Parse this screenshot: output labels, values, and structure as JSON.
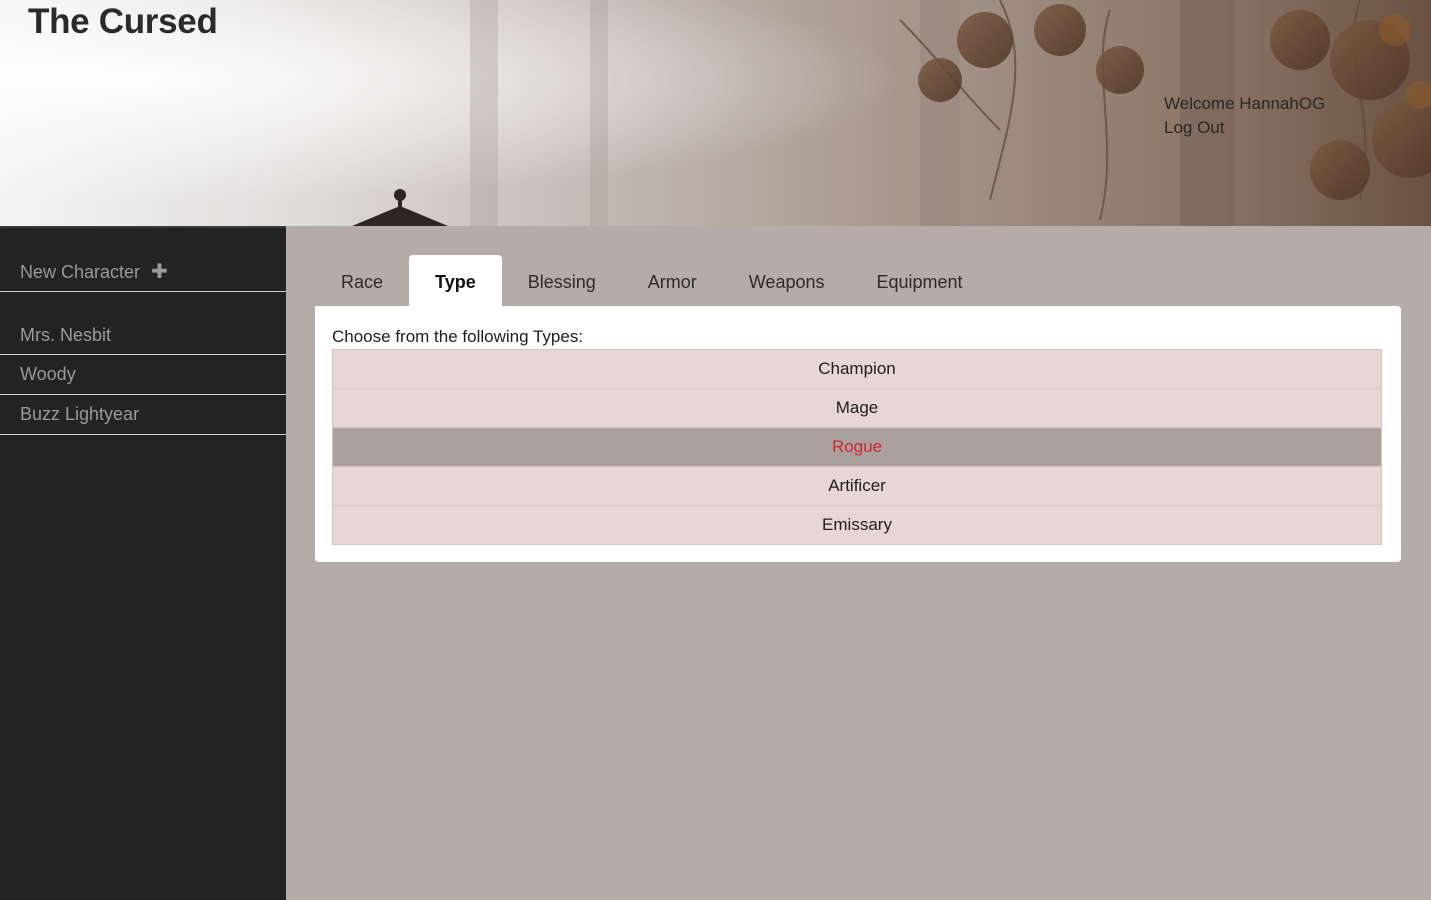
{
  "header": {
    "title": "The Cursed",
    "welcome_text": "Welcome HannahOG",
    "logout_label": "Log Out"
  },
  "sidebar": {
    "new_character_label": "New Character",
    "new_character_icon": "plus-icon",
    "characters": [
      {
        "name": "Mrs. Nesbit"
      },
      {
        "name": "Woody"
      },
      {
        "name": "Buzz Lightyear"
      }
    ]
  },
  "tabs": [
    {
      "label": "Race",
      "active": false
    },
    {
      "label": "Type",
      "active": true
    },
    {
      "label": "Blessing",
      "active": false
    },
    {
      "label": "Armor",
      "active": false
    },
    {
      "label": "Weapons",
      "active": false
    },
    {
      "label": "Equipment",
      "active": false
    }
  ],
  "panel": {
    "prompt": "Choose from the following Types:",
    "types": [
      {
        "label": "Champion",
        "selected": false
      },
      {
        "label": "Mage",
        "selected": false
      },
      {
        "label": "Rogue",
        "selected": true
      },
      {
        "label": "Artificer",
        "selected": false
      },
      {
        "label": "Emissary",
        "selected": false
      }
    ]
  },
  "colors": {
    "sidebar_bg": "#232323",
    "main_bg": "#b5aba9",
    "list_item_bg": "#e8d6d5",
    "selected_item_bg": "#aca09e",
    "selected_item_text": "#d0292d"
  }
}
